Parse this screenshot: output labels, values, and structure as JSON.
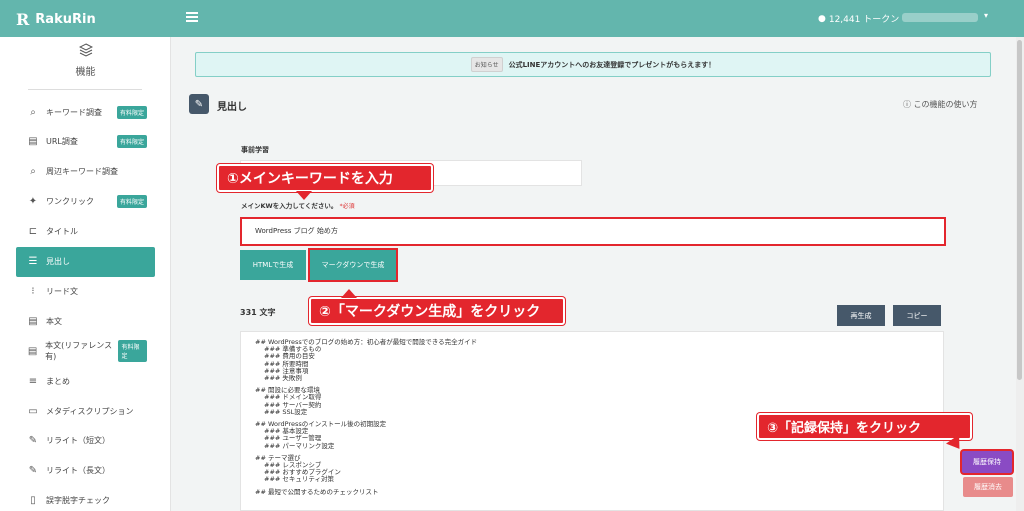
{
  "app": {
    "brand": "RakuRin",
    "brand_mark": "R"
  },
  "topbar": {
    "token_icon": "chat-bubble-icon",
    "tokens": "12,441 トークン"
  },
  "sidebar": {
    "section_label": "機能",
    "items": [
      {
        "label": "キーワード調査",
        "badge": "有料限定",
        "icon": "keyword-search-icon"
      },
      {
        "label": "URL調査",
        "badge": "有料限定",
        "icon": "url-research-icon"
      },
      {
        "label": "周辺キーワード調査",
        "badge": "",
        "icon": "related-keyword-icon"
      },
      {
        "label": "ワンクリック",
        "badge": "有料限定",
        "icon": "one-click-icon"
      },
      {
        "label": "タイトル",
        "badge": "",
        "icon": "title-icon"
      },
      {
        "label": "見出し",
        "badge": "",
        "icon": "headings-icon",
        "active": true
      },
      {
        "label": "リード文",
        "badge": "",
        "icon": "lead-text-icon"
      },
      {
        "label": "本文",
        "badge": "",
        "icon": "body-text-icon"
      },
      {
        "label": "本文(リファレンス有)",
        "badge": "有料限定",
        "icon": "body-reference-icon"
      },
      {
        "label": "まとめ",
        "badge": "",
        "icon": "summary-icon"
      },
      {
        "label": "メタディスクリプション",
        "badge": "",
        "icon": "meta-description-icon"
      },
      {
        "label": "リライト（短文）",
        "badge": "",
        "icon": "rewrite-short-icon"
      },
      {
        "label": "リライト（長文）",
        "badge": "",
        "icon": "rewrite-long-icon"
      },
      {
        "label": "誤字脱字チェック",
        "badge": "",
        "icon": "typo-check-icon"
      }
    ]
  },
  "notice": {
    "tag": "お知らせ",
    "text": "公式LINEアカウントへのお友達登録でプレゼントがもらえます！"
  },
  "page": {
    "title": "見出し",
    "help": "この機能の使い方"
  },
  "form": {
    "section_label": "事前学習",
    "keyword_label": "メインKWを入力してください。",
    "required": "*必須",
    "keyword_value": "WordPress ブログ 始め方",
    "btn_html": "HTMLで生成",
    "btn_markdown": "マークダウンで生成"
  },
  "result": {
    "char_count": "331 文字",
    "btn_regenerate": "再生成",
    "btn_copy": "コピー",
    "lines": [
      {
        "level": "h2",
        "text": "## WordPressでのブログの始め方：初心者が最短で開設できる完全ガイド"
      },
      {
        "level": "h3",
        "text": "### 準備するもの"
      },
      {
        "level": "h3",
        "text": "### 費用の目安"
      },
      {
        "level": "h3",
        "text": "### 所要時間"
      },
      {
        "level": "h3",
        "text": "### 注意事項"
      },
      {
        "level": "h3",
        "text": "### 失敗例"
      },
      {
        "level": "gap",
        "text": ""
      },
      {
        "level": "h2",
        "text": "## 開設に必要な環境"
      },
      {
        "level": "h3",
        "text": "### ドメイン取得"
      },
      {
        "level": "h3",
        "text": "### サーバー契約"
      },
      {
        "level": "h3",
        "text": "### SSL設定"
      },
      {
        "level": "gap",
        "text": ""
      },
      {
        "level": "h2",
        "text": "## WordPressのインストール後の初期設定"
      },
      {
        "level": "h3",
        "text": "### 基本設定"
      },
      {
        "level": "h3",
        "text": "### ユーザー管理"
      },
      {
        "level": "h3",
        "text": "### パーマリンク設定"
      },
      {
        "level": "gap",
        "text": ""
      },
      {
        "level": "h2",
        "text": "## テーマ選び"
      },
      {
        "level": "h3",
        "text": "### レスポンシブ"
      },
      {
        "level": "h3",
        "text": "### おすすめプラグイン"
      },
      {
        "level": "h3",
        "text": "### セキュリティ対策"
      },
      {
        "level": "gap",
        "text": ""
      },
      {
        "level": "h2",
        "text": "## 最短で公開するためのチェックリスト"
      }
    ],
    "btn_save": "履歴保持",
    "btn_clear": "履歴消去"
  },
  "callouts": {
    "step1": "①メインキーワードを入力",
    "step2": "②「マークダウン生成」をクリック",
    "step3": "③「記録保持」をクリック"
  },
  "colors": {
    "topbar": "#63b6ad",
    "accent": "#3aa69b",
    "dark_button": "#46586a",
    "save": "#8a4bc4",
    "clear": "#e88b8b",
    "highlight": "#e3262d"
  }
}
